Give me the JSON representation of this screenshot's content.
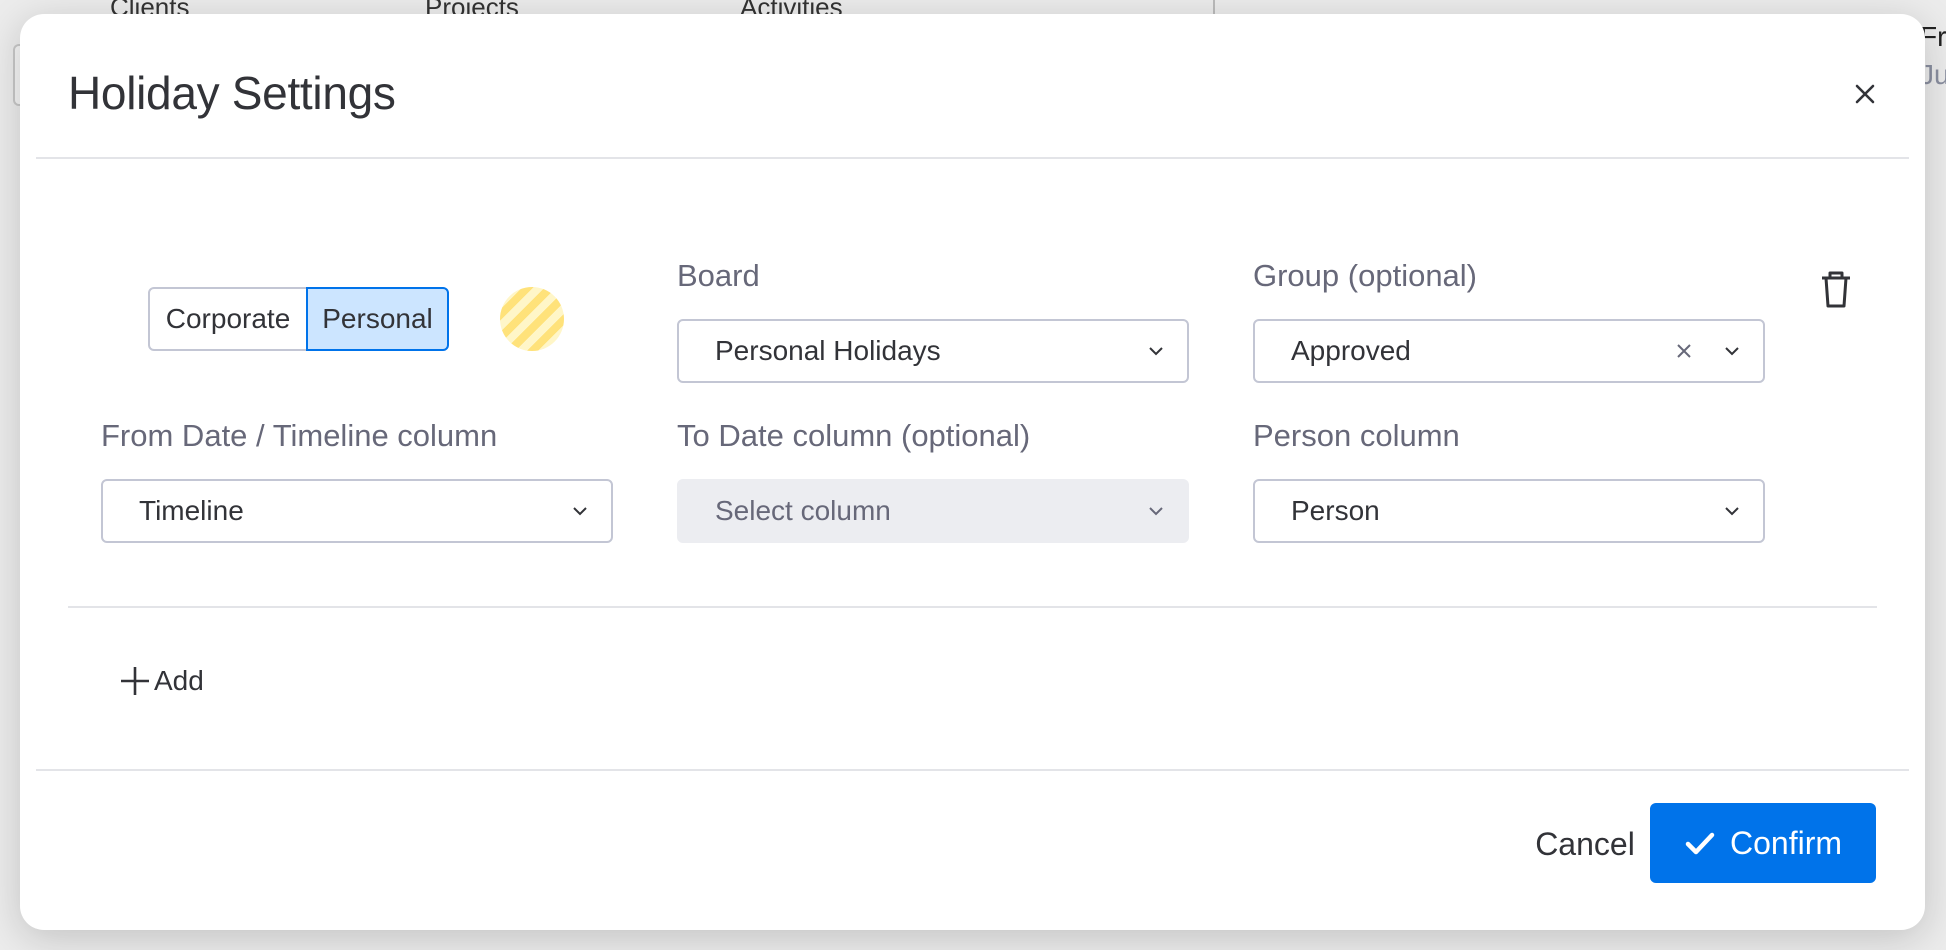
{
  "background": {
    "tabs": [
      "Clients",
      "Projects",
      "Activities"
    ],
    "right_text": [
      "Fri",
      "Ju"
    ]
  },
  "modal": {
    "title": "Holiday Settings",
    "close_icon": "close-icon"
  },
  "rule": {
    "type_toggle": {
      "options": [
        "Corporate",
        "Personal"
      ],
      "selected": "Personal"
    },
    "color_swatch": "yellow-striped",
    "board": {
      "label": "Board",
      "value": "Personal Holidays"
    },
    "group": {
      "label": "Group (optional)",
      "value": "Approved"
    },
    "from_date": {
      "label": "From Date / Timeline column",
      "value": "Timeline"
    },
    "to_date": {
      "label": "To Date column (optional)",
      "placeholder": "Select column"
    },
    "person": {
      "label": "Person column",
      "value": "Person"
    }
  },
  "actions": {
    "add_label": "Add",
    "cancel_label": "Cancel",
    "confirm_label": "Confirm"
  },
  "colors": {
    "primary": "#0073ea",
    "selected_toggle": "#cce5ff",
    "swatch": "#ffe27a"
  }
}
